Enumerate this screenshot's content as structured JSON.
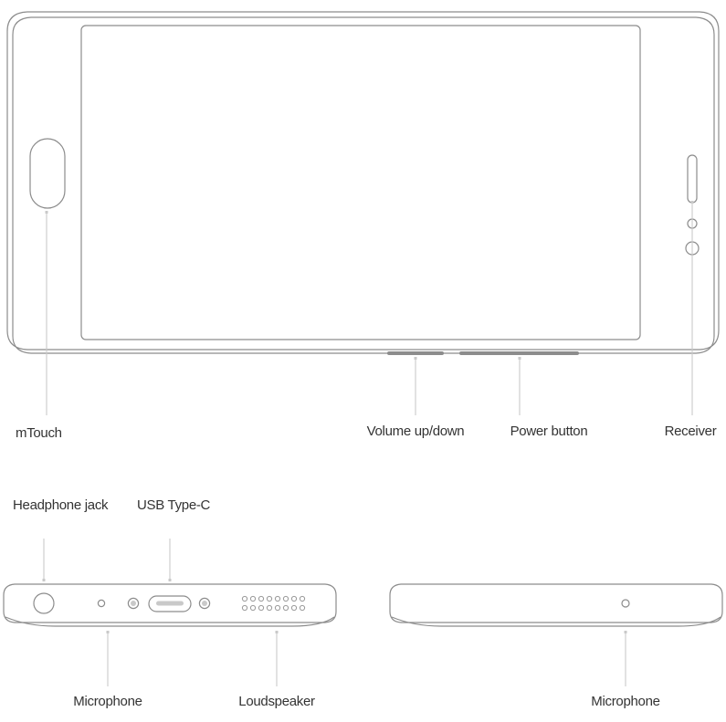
{
  "diagram": {
    "title": "Smartphone hardware callout diagram",
    "stroke_color": "#8c8c8c",
    "leader_color": "#c9c9c9",
    "label_color": "#333333",
    "background": "#ffffff"
  },
  "views": {
    "front": {
      "name": "front-view",
      "orientation": "landscape"
    },
    "bottom_edge": {
      "name": "bottom-edge-view"
    },
    "top_edge": {
      "name": "top-edge-view"
    }
  },
  "components": {
    "mtouch": {
      "label": "mTouch",
      "icon": "home-button-icon"
    },
    "volume": {
      "label": "Volume up/down",
      "icon": "volume-rocker-icon"
    },
    "power": {
      "label": "Power button",
      "icon": "power-button-icon"
    },
    "receiver": {
      "label": "Receiver",
      "icon": "earpiece-slot-icon"
    },
    "headphone": {
      "label": "Headphone jack",
      "icon": "headphone-jack-icon"
    },
    "usb": {
      "label": "USB Type-C",
      "icon": "usb-c-port-icon"
    },
    "microphone_bottom": {
      "label": "Microphone",
      "icon": "microphone-hole-icon"
    },
    "loudspeaker": {
      "label": "Loudspeaker",
      "icon": "speaker-grille-icon"
    },
    "microphone_top": {
      "label": "Microphone",
      "icon": "microphone-hole-icon"
    }
  },
  "speaker_grille": {
    "rows": 2,
    "holes_per_row": 8
  }
}
